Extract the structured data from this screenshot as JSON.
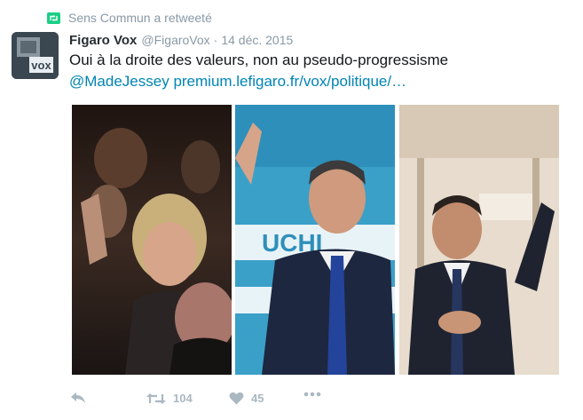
{
  "retweet_context": {
    "text": "Sens Commun a retweeté",
    "icon": "retweet-icon",
    "color": "#19cf86"
  },
  "tweet": {
    "author": {
      "name": "Figaro Vox",
      "handle": "@FigaroVox",
      "avatar_text": "vox"
    },
    "separator": "·",
    "time": "14 déc. 2015",
    "text": "Oui à la droite des valeurs, non au pseudo-progressisme",
    "mention": "@MadeJessey",
    "url": "premium.lefigaro.fr/vox/politique/…"
  },
  "media": [
    {
      "subject": "woman-waving-in-crowd"
    },
    {
      "subject": "man-in-suit-waving"
    },
    {
      "subject": "man-hand-on-heart"
    }
  ],
  "actions": {
    "reply_icon": "reply-icon",
    "retweet_icon": "retweet-icon",
    "retweet_count": "104",
    "like_icon": "heart-icon",
    "like_count": "45",
    "more_icon": "more-icon"
  },
  "colors": {
    "link": "#0084b4",
    "muted": "#8899a6",
    "action": "#aab8c2"
  }
}
